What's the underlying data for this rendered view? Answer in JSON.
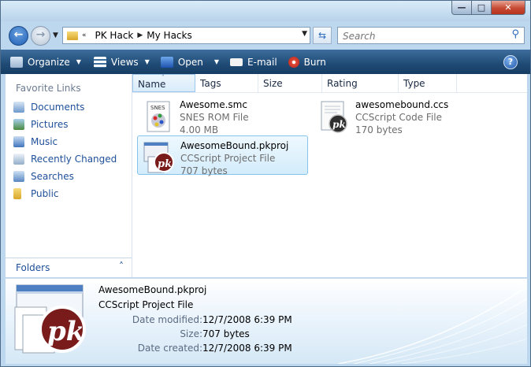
{
  "address": {
    "crumbs": [
      "PK Hack",
      "My Hacks"
    ]
  },
  "search": {
    "placeholder": "Search"
  },
  "toolbar": {
    "organize": "Organize",
    "views": "Views",
    "open": "Open",
    "email": "E-mail",
    "burn": "Burn"
  },
  "sidebar": {
    "title": "Favorite Links",
    "items": [
      {
        "label": "Documents",
        "icon": "documents-icon"
      },
      {
        "label": "Pictures",
        "icon": "pictures-icon"
      },
      {
        "label": "Music",
        "icon": "music-icon"
      },
      {
        "label": "Recently Changed",
        "icon": "recently-changed-icon"
      },
      {
        "label": "Searches",
        "icon": "searches-icon"
      },
      {
        "label": "Public",
        "icon": "public-folder-icon"
      }
    ],
    "folders_label": "Folders"
  },
  "columns": [
    "Name",
    "Tags",
    "Size",
    "Rating",
    "Type"
  ],
  "files": [
    {
      "name": "Awesome.smc",
      "type": "SNES ROM File",
      "size": "4.00 MB",
      "icon": "snes-rom-icon",
      "selected": false
    },
    {
      "name": "awesomebound.ccs",
      "type": "CCScript Code File",
      "size": "170 bytes",
      "icon": "ccscript-file-icon",
      "selected": false
    },
    {
      "name": "AwesomeBound.pkproj",
      "type": "CCScript Project File",
      "size": "707 bytes",
      "icon": "pk-project-icon",
      "selected": true
    }
  ],
  "details": {
    "name": "AwesomeBound.pkproj",
    "type": "CCScript Project File",
    "rows": [
      {
        "label": "Date modified:",
        "value": "12/7/2008 6:39 PM"
      },
      {
        "label": "Size:",
        "value": "707 bytes"
      },
      {
        "label": "Date created:",
        "value": "12/7/2008 6:39 PM"
      }
    ]
  }
}
